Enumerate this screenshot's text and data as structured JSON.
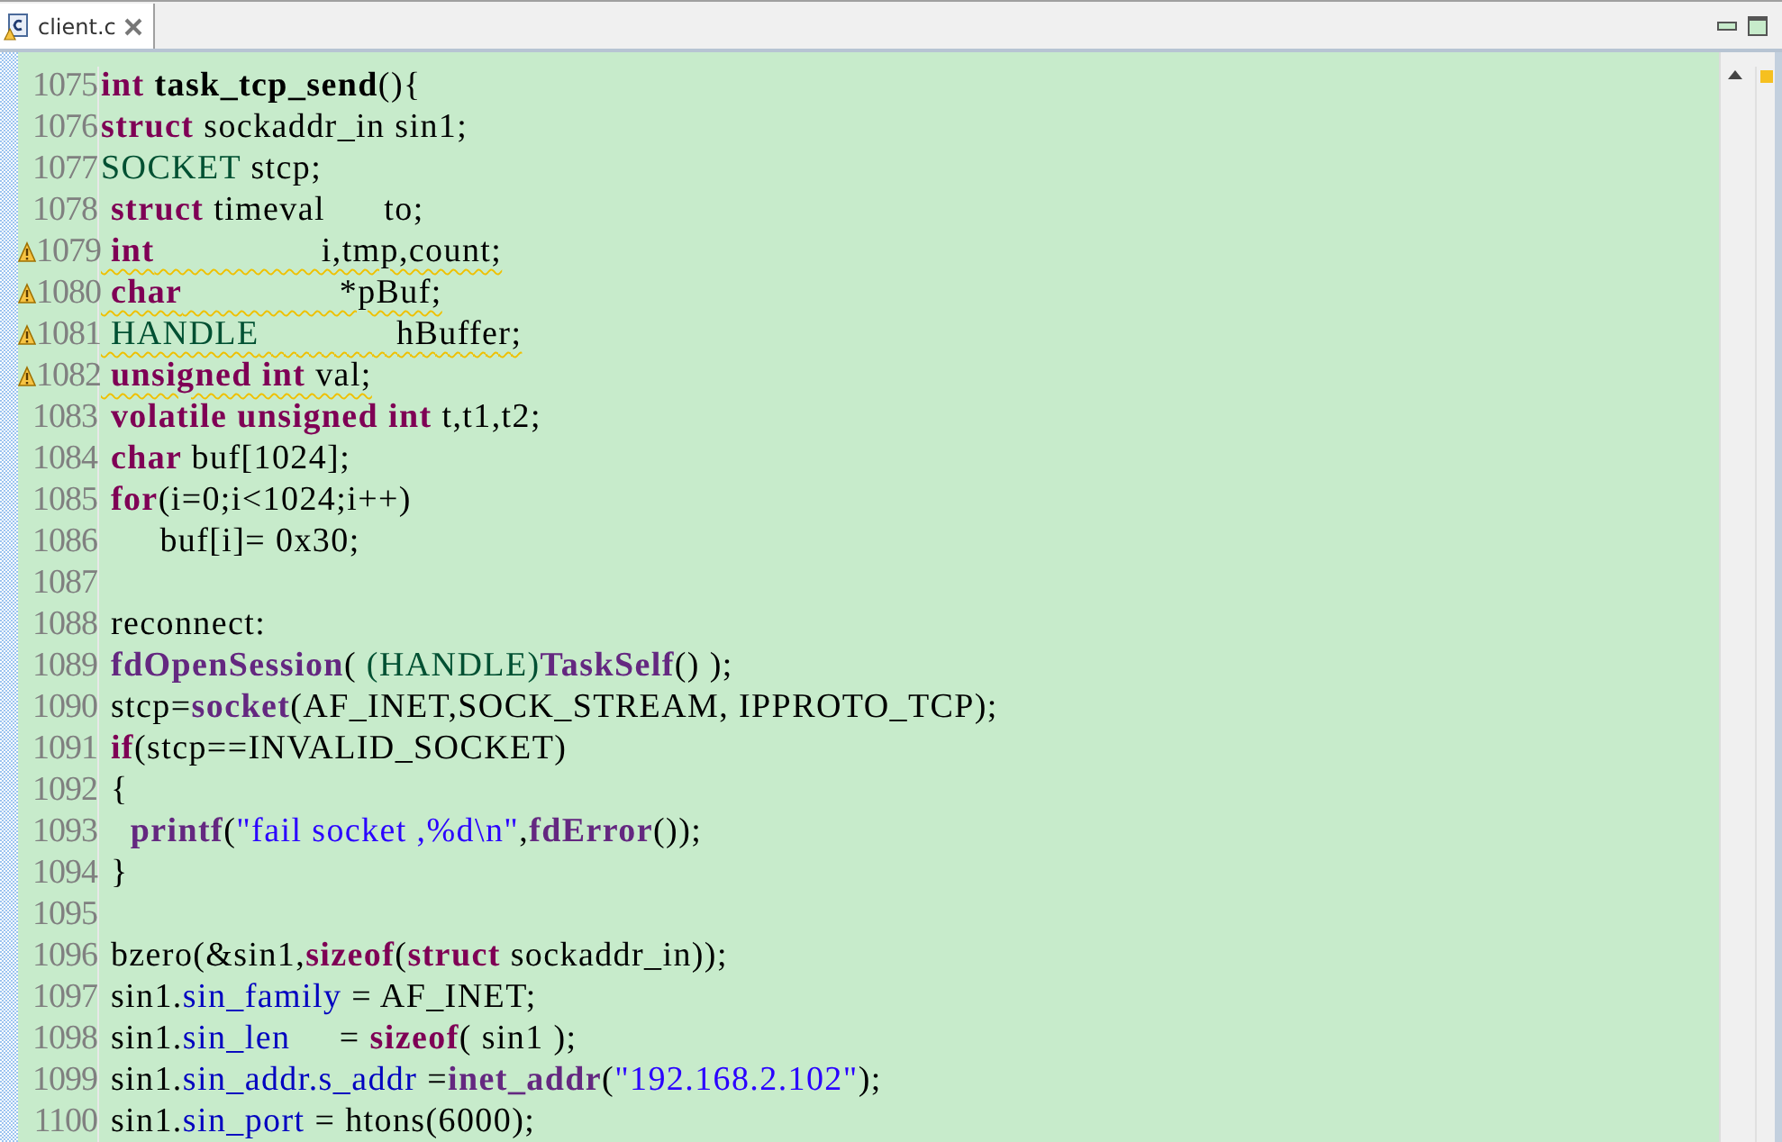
{
  "tab": {
    "label": "client.c",
    "selected": true
  },
  "lines": [
    {
      "number": "1075",
      "warning": false,
      "tokens": [
        {
          "text": "int ",
          "kind": "keyword"
        },
        {
          "text": "task_tcp_send",
          "kind": "bold"
        },
        {
          "text": "(){",
          "kind": "plain"
        }
      ]
    },
    {
      "number": "1076",
      "warning": false,
      "tokens": [
        {
          "text": "struct ",
          "kind": "keyword"
        },
        {
          "text": "sockaddr_in sin1;",
          "kind": "plain"
        }
      ]
    },
    {
      "number": "1077",
      "warning": false,
      "tokens": [
        {
          "text": "SOCKET",
          "kind": "type"
        },
        {
          "text": " stcp;",
          "kind": "plain"
        }
      ]
    },
    {
      "number": "1078",
      "warning": false,
      "tokens": [
        {
          "text": " struct ",
          "kind": "keyword"
        },
        {
          "text": "timeval      to;",
          "kind": "plain"
        }
      ]
    },
    {
      "number": "1079",
      "warning": true,
      "tokens": [
        {
          "text": " int",
          "kind": "keyword"
        },
        {
          "text": "                 i,tmp,count;",
          "kind": "plain"
        }
      ]
    },
    {
      "number": "1080",
      "warning": true,
      "tokens": [
        {
          "text": " char",
          "kind": "keyword"
        },
        {
          "text": "                *pBuf;",
          "kind": "plain"
        }
      ]
    },
    {
      "number": "1081",
      "warning": true,
      "tokens": [
        {
          "text": " HANDLE",
          "kind": "type"
        },
        {
          "text": "              hBuffer;",
          "kind": "plain"
        }
      ]
    },
    {
      "number": "1082",
      "warning": true,
      "tokens": [
        {
          "text": " unsigned int ",
          "kind": "keyword"
        },
        {
          "text": "val;",
          "kind": "plain"
        }
      ]
    },
    {
      "number": "1083",
      "warning": false,
      "tokens": [
        {
          "text": " volatile unsigned int ",
          "kind": "keyword"
        },
        {
          "text": "t,t1,t2;",
          "kind": "plain"
        }
      ]
    },
    {
      "number": "1084",
      "warning": false,
      "tokens": [
        {
          "text": " char ",
          "kind": "keyword"
        },
        {
          "text": "buf[1024];",
          "kind": "plain"
        }
      ]
    },
    {
      "number": "1085",
      "warning": false,
      "tokens": [
        {
          "text": " for",
          "kind": "keyword"
        },
        {
          "text": "(i=0;i<1024;i++)",
          "kind": "plain"
        }
      ]
    },
    {
      "number": "1086",
      "warning": false,
      "tokens": [
        {
          "text": "      buf[i]= 0x30;",
          "kind": "plain"
        }
      ]
    },
    {
      "number": "1087",
      "warning": false
    },
    {
      "number": "1088",
      "warning": false,
      "tokens": [
        {
          "text": " reconnect:",
          "kind": "plain"
        }
      ]
    },
    {
      "number": "1089",
      "warning": false,
      "tokens": [
        {
          "text": " fdOpenSession",
          "kind": "func"
        },
        {
          "text": "( ",
          "kind": "plain"
        },
        {
          "text": "(HANDLE)",
          "kind": "type"
        },
        {
          "text": "TaskSelf",
          "kind": "func"
        },
        {
          "text": "() );",
          "kind": "plain"
        }
      ]
    },
    {
      "number": "1090",
      "warning": false,
      "tokens": [
        {
          "text": " stcp=",
          "kind": "plain"
        },
        {
          "text": "socket",
          "kind": "func"
        },
        {
          "text": "(AF_INET,SOCK_STREAM, IPPROTO_TCP);",
          "kind": "plain"
        }
      ]
    },
    {
      "number": "1091",
      "warning": false,
      "tokens": [
        {
          "text": " if",
          "kind": "keyword"
        },
        {
          "text": "(stcp==INVALID_SOCKET)",
          "kind": "plain"
        }
      ]
    },
    {
      "number": "1092",
      "warning": false,
      "tokens": [
        {
          "text": " {",
          "kind": "plain"
        }
      ]
    },
    {
      "number": "1093",
      "warning": false,
      "tokens": [
        {
          "text": "   printf",
          "kind": "func"
        },
        {
          "text": "(",
          "kind": "plain"
        },
        {
          "text": "\"fail socket ,%d\\n\"",
          "kind": "string"
        },
        {
          "text": ",",
          "kind": "plain"
        },
        {
          "text": "fdError",
          "kind": "func"
        },
        {
          "text": "());",
          "kind": "plain"
        }
      ]
    },
    {
      "number": "1094",
      "warning": false,
      "tokens": [
        {
          "text": " }",
          "kind": "plain"
        }
      ]
    },
    {
      "number": "1095",
      "warning": false
    },
    {
      "number": "1096",
      "warning": false,
      "tokens": [
        {
          "text": " bzero(&sin1,",
          "kind": "plain"
        },
        {
          "text": "sizeof",
          "kind": "keyword"
        },
        {
          "text": "(",
          "kind": "plain"
        },
        {
          "text": "struct ",
          "kind": "keyword"
        },
        {
          "text": "sockaddr_in));",
          "kind": "plain"
        }
      ]
    },
    {
      "number": "1097",
      "warning": false,
      "tokens": [
        {
          "text": " sin1.",
          "kind": "plain"
        },
        {
          "text": "sin_family",
          "kind": "field"
        },
        {
          "text": " = AF_INET;",
          "kind": "plain"
        }
      ]
    },
    {
      "number": "1098",
      "warning": false,
      "tokens": [
        {
          "text": " sin1.",
          "kind": "plain"
        },
        {
          "text": "sin_len",
          "kind": "field"
        },
        {
          "text": "     = ",
          "kind": "plain"
        },
        {
          "text": "sizeof",
          "kind": "keyword"
        },
        {
          "text": "( sin1 );",
          "kind": "plain"
        }
      ]
    },
    {
      "number": "1099",
      "warning": false,
      "tokens": [
        {
          "text": " sin1.",
          "kind": "plain"
        },
        {
          "text": "sin_addr.s_addr",
          "kind": "field"
        },
        {
          "text": " =",
          "kind": "plain"
        },
        {
          "text": "inet_addr",
          "kind": "func"
        },
        {
          "text": "(",
          "kind": "plain"
        },
        {
          "text": "\"192.168.2.102\"",
          "kind": "string"
        },
        {
          "text": ");",
          "kind": "plain"
        }
      ]
    },
    {
      "number": "1100",
      "warning": false,
      "tokens": [
        {
          "text": " sin1.",
          "kind": "plain"
        },
        {
          "text": "sin_port",
          "kind": "field"
        },
        {
          "text": " = htons(6000);",
          "kind": "plain"
        }
      ]
    }
  ]
}
